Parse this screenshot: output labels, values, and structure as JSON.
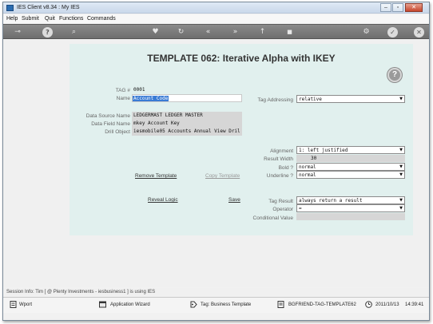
{
  "window": {
    "title": "IES Client v8.34 : My IES",
    "minimize": "–",
    "maximize": "▫",
    "close": "✕"
  },
  "menu": {
    "items": [
      "Help",
      "Submit",
      "Quit",
      "Functions",
      "Commands"
    ]
  },
  "toolbar": {
    "icons": [
      "key-icon",
      "help-icon",
      "search-icon",
      "heart-icon",
      "refresh-icon",
      "rewind-icon",
      "fast-forward-icon",
      "upload-icon",
      "stop-icon",
      "settings-icon",
      "check-icon",
      "close-icon"
    ],
    "glyphs": {
      "key": "⊸",
      "help": "?",
      "search": "⌕",
      "heart": "♥",
      "refresh": "↻",
      "rewind": "«",
      "ff": "»",
      "upload": "↑",
      "stop": "■",
      "settings": "⚙",
      "check": "✓",
      "close": "✕"
    }
  },
  "panel": {
    "title": "TEMPLATE 062: Iterative  Alpha with IKEY",
    "help_glyph": "?",
    "tag_label": "TAG #",
    "tag_value": "0001",
    "name_label": "Name",
    "name_value": "Account Code",
    "tag_addressing_label": "Tag Addressing",
    "tag_addressing_value": "relative",
    "data_source_label": "Data Source Name",
    "data_source_value": "LEDGERMAST LEDGER MASTER",
    "data_field_label": "Data Field Name",
    "data_field_value": "mkey Account Key",
    "drill_object_label": "Drill Object",
    "drill_object_value": "iesmobile05 Accounts Annual View Dril",
    "alignment_label": "Alignment",
    "alignment_value": "1: left justified",
    "result_width_label": "Result Width",
    "result_width_value": "30",
    "bold_label": "Bold ?",
    "bold_value": "normal",
    "underline_label": "Underline ?",
    "underline_value": "normal",
    "remove_template": "Remove Template",
    "copy_template": "Copy Template",
    "reveal_logic": "Reveal Logic",
    "save": "Save",
    "tag_result_label": "Tag Result",
    "tag_result_value": "always return a result",
    "operator_label": "Operator",
    "operator_value": "=",
    "conditional_value_label": "Conditional Value",
    "conditional_value_value": "",
    "dropdown_arrow": "▼"
  },
  "session": {
    "text": "Session Info: Tim [ @ Plenty Investments  - iesbusiness1 ] is using IES"
  },
  "statusbar": {
    "wport": "Wport",
    "app_wizard": "Application Wizard",
    "tag": "Tag: Business Template",
    "friend": "BGFRIEND-TAG-TEMPLATE62",
    "date": "2011/10/13",
    "time": "14:39:41"
  }
}
